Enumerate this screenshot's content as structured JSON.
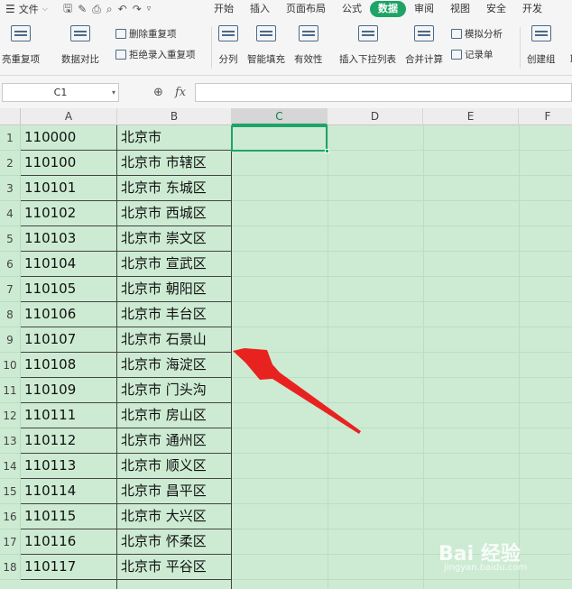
{
  "menubar": {
    "file_label": "文件",
    "tabs": [
      {
        "label": "开始",
        "active": false
      },
      {
        "label": "插入",
        "active": false
      },
      {
        "label": "页面布局",
        "active": false
      },
      {
        "label": "公式",
        "active": false
      },
      {
        "label": "数据",
        "active": true
      },
      {
        "label": "审阅",
        "active": false
      },
      {
        "label": "视图",
        "active": false
      },
      {
        "label": "安全",
        "active": false
      },
      {
        "label": "开发",
        "active": false
      }
    ]
  },
  "ribbon": {
    "highlight_dup": "亮重复项",
    "data_compare": "数据对比",
    "delete_dup": "删除重复项",
    "reject_dup": "拒绝录入重复项",
    "split": "分列",
    "smart_fill": "智能填充",
    "validity": "有效性",
    "insert_dropdown": "插入下拉列表",
    "merge_calc": "合并计算",
    "sim_analysis": "模拟分析",
    "record_form": "记录单",
    "create_group": "创建组",
    "cancel_group": "取"
  },
  "formula_bar": {
    "name_box": "C1",
    "fx_label": "fx",
    "value": ""
  },
  "columns": [
    "A",
    "B",
    "C",
    "D",
    "E",
    "F"
  ],
  "rows": [
    {
      "num": "1",
      "a": "110000",
      "b": "北京市"
    },
    {
      "num": "2",
      "a": "110100",
      "b": "北京市  市辖区"
    },
    {
      "num": "3",
      "a": "110101",
      "b": "北京市  东城区"
    },
    {
      "num": "4",
      "a": "110102",
      "b": "北京市  西城区"
    },
    {
      "num": "5",
      "a": "110103",
      "b": "北京市  崇文区"
    },
    {
      "num": "6",
      "a": "110104",
      "b": "北京市  宣武区"
    },
    {
      "num": "7",
      "a": "110105",
      "b": "北京市  朝阳区"
    },
    {
      "num": "8",
      "a": "110106",
      "b": "北京市  丰台区"
    },
    {
      "num": "9",
      "a": "110107",
      "b": "北京市  石景山"
    },
    {
      "num": "10",
      "a": "110108",
      "b": "北京市  海淀区"
    },
    {
      "num": "11",
      "a": "110109",
      "b": "北京市  门头沟"
    },
    {
      "num": "12",
      "a": "110111",
      "b": "北京市  房山区"
    },
    {
      "num": "13",
      "a": "110112",
      "b": "北京市  通州区"
    },
    {
      "num": "14",
      "a": "110113",
      "b": "北京市  顺义区"
    },
    {
      "num": "15",
      "a": "110114",
      "b": "北京市  昌平区"
    },
    {
      "num": "16",
      "a": "110115",
      "b": "北京市  大兴区"
    },
    {
      "num": "17",
      "a": "110116",
      "b": "北京市  怀柔区"
    },
    {
      "num": "18",
      "a": "110117",
      "b": "北京市  平谷区"
    }
  ],
  "selected_cell": "C1",
  "watermark": {
    "text": "Bai 经验",
    "sub": "jingyan.baidu.com"
  },
  "colors": {
    "accent": "#1fa367",
    "sheet_bg": "#cdebd3",
    "arrow": "#e8231f"
  },
  "icons": [
    "menu-icon",
    "save-icon",
    "undo-icon",
    "redo-icon",
    "zoom-icon",
    "fx-icon",
    "arrow-annotation"
  ]
}
